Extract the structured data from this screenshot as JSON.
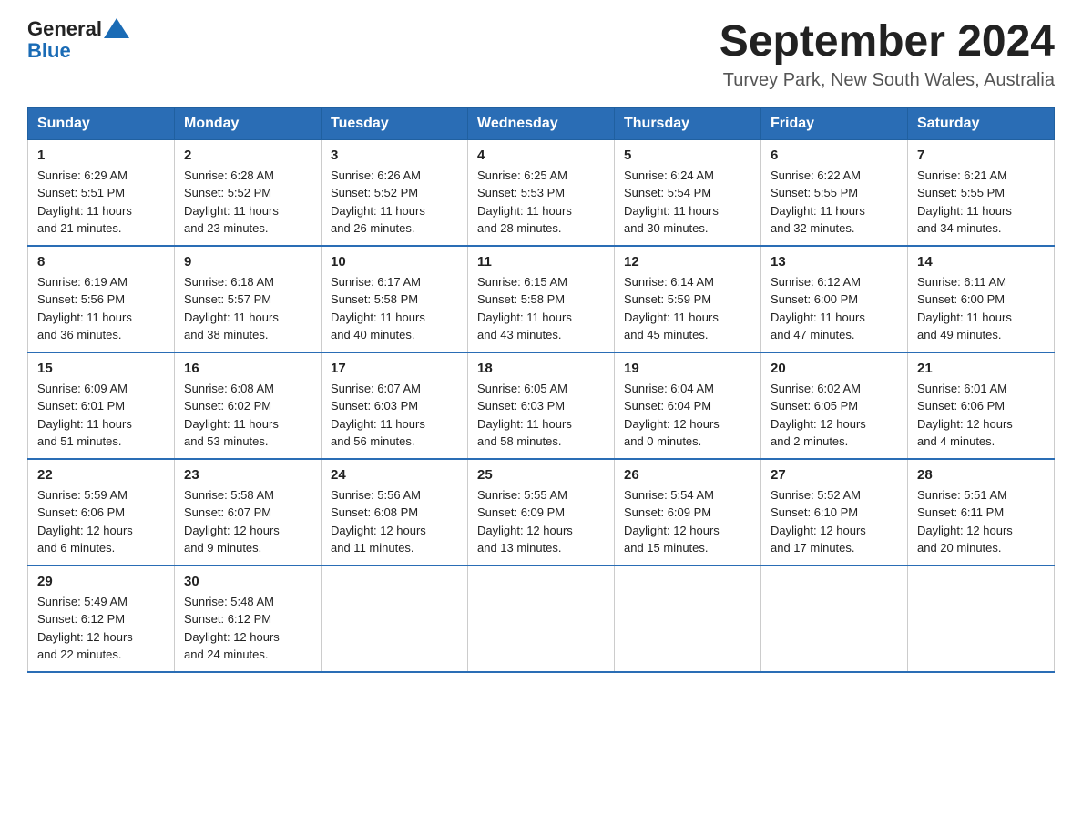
{
  "logo": {
    "text_general": "General",
    "text_blue": "Blue",
    "arrow_symbol": "▶"
  },
  "title": {
    "month_year": "September 2024",
    "location": "Turvey Park, New South Wales, Australia"
  },
  "weekdays": [
    "Sunday",
    "Monday",
    "Tuesday",
    "Wednesday",
    "Thursday",
    "Friday",
    "Saturday"
  ],
  "weeks": [
    [
      {
        "day": "1",
        "sunrise": "6:29 AM",
        "sunset": "5:51 PM",
        "daylight": "11 hours and 21 minutes."
      },
      {
        "day": "2",
        "sunrise": "6:28 AM",
        "sunset": "5:52 PM",
        "daylight": "11 hours and 23 minutes."
      },
      {
        "day": "3",
        "sunrise": "6:26 AM",
        "sunset": "5:52 PM",
        "daylight": "11 hours and 26 minutes."
      },
      {
        "day": "4",
        "sunrise": "6:25 AM",
        "sunset": "5:53 PM",
        "daylight": "11 hours and 28 minutes."
      },
      {
        "day": "5",
        "sunrise": "6:24 AM",
        "sunset": "5:54 PM",
        "daylight": "11 hours and 30 minutes."
      },
      {
        "day": "6",
        "sunrise": "6:22 AM",
        "sunset": "5:55 PM",
        "daylight": "11 hours and 32 minutes."
      },
      {
        "day": "7",
        "sunrise": "6:21 AM",
        "sunset": "5:55 PM",
        "daylight": "11 hours and 34 minutes."
      }
    ],
    [
      {
        "day": "8",
        "sunrise": "6:19 AM",
        "sunset": "5:56 PM",
        "daylight": "11 hours and 36 minutes."
      },
      {
        "day": "9",
        "sunrise": "6:18 AM",
        "sunset": "5:57 PM",
        "daylight": "11 hours and 38 minutes."
      },
      {
        "day": "10",
        "sunrise": "6:17 AM",
        "sunset": "5:58 PM",
        "daylight": "11 hours and 40 minutes."
      },
      {
        "day": "11",
        "sunrise": "6:15 AM",
        "sunset": "5:58 PM",
        "daylight": "11 hours and 43 minutes."
      },
      {
        "day": "12",
        "sunrise": "6:14 AM",
        "sunset": "5:59 PM",
        "daylight": "11 hours and 45 minutes."
      },
      {
        "day": "13",
        "sunrise": "6:12 AM",
        "sunset": "6:00 PM",
        "daylight": "11 hours and 47 minutes."
      },
      {
        "day": "14",
        "sunrise": "6:11 AM",
        "sunset": "6:00 PM",
        "daylight": "11 hours and 49 minutes."
      }
    ],
    [
      {
        "day": "15",
        "sunrise": "6:09 AM",
        "sunset": "6:01 PM",
        "daylight": "11 hours and 51 minutes."
      },
      {
        "day": "16",
        "sunrise": "6:08 AM",
        "sunset": "6:02 PM",
        "daylight": "11 hours and 53 minutes."
      },
      {
        "day": "17",
        "sunrise": "6:07 AM",
        "sunset": "6:03 PM",
        "daylight": "11 hours and 56 minutes."
      },
      {
        "day": "18",
        "sunrise": "6:05 AM",
        "sunset": "6:03 PM",
        "daylight": "11 hours and 58 minutes."
      },
      {
        "day": "19",
        "sunrise": "6:04 AM",
        "sunset": "6:04 PM",
        "daylight": "12 hours and 0 minutes."
      },
      {
        "day": "20",
        "sunrise": "6:02 AM",
        "sunset": "6:05 PM",
        "daylight": "12 hours and 2 minutes."
      },
      {
        "day": "21",
        "sunrise": "6:01 AM",
        "sunset": "6:06 PM",
        "daylight": "12 hours and 4 minutes."
      }
    ],
    [
      {
        "day": "22",
        "sunrise": "5:59 AM",
        "sunset": "6:06 PM",
        "daylight": "12 hours and 6 minutes."
      },
      {
        "day": "23",
        "sunrise": "5:58 AM",
        "sunset": "6:07 PM",
        "daylight": "12 hours and 9 minutes."
      },
      {
        "day": "24",
        "sunrise": "5:56 AM",
        "sunset": "6:08 PM",
        "daylight": "12 hours and 11 minutes."
      },
      {
        "day": "25",
        "sunrise": "5:55 AM",
        "sunset": "6:09 PM",
        "daylight": "12 hours and 13 minutes."
      },
      {
        "day": "26",
        "sunrise": "5:54 AM",
        "sunset": "6:09 PM",
        "daylight": "12 hours and 15 minutes."
      },
      {
        "day": "27",
        "sunrise": "5:52 AM",
        "sunset": "6:10 PM",
        "daylight": "12 hours and 17 minutes."
      },
      {
        "day": "28",
        "sunrise": "5:51 AM",
        "sunset": "6:11 PM",
        "daylight": "12 hours and 20 minutes."
      }
    ],
    [
      {
        "day": "29",
        "sunrise": "5:49 AM",
        "sunset": "6:12 PM",
        "daylight": "12 hours and 22 minutes."
      },
      {
        "day": "30",
        "sunrise": "5:48 AM",
        "sunset": "6:12 PM",
        "daylight": "12 hours and 24 minutes."
      },
      null,
      null,
      null,
      null,
      null
    ]
  ]
}
